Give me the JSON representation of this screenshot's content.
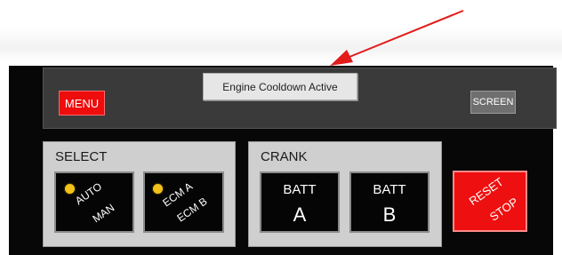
{
  "header": {
    "menu_label": "MENU",
    "screen_label": "SCREEN",
    "status_text": "Engine Cooldown Active"
  },
  "select_group": {
    "label": "SELECT",
    "auto_man": {
      "top": "AUTO",
      "bottom": "MAN",
      "indicator_color": "#f3c21a"
    },
    "ecm": {
      "top": "ECM A",
      "bottom": "ECM B",
      "indicator_color": "#f3c21a"
    }
  },
  "crank_group": {
    "label": "CRANK",
    "batt_a": {
      "line1": "BATT",
      "line2": "A"
    },
    "batt_b": {
      "line1": "BATT",
      "line2": "B"
    }
  },
  "reset_stop": {
    "top": "RESET",
    "bottom": "STOP",
    "color": "#ee1010"
  },
  "annotation_arrow_color": "#e21b1b"
}
